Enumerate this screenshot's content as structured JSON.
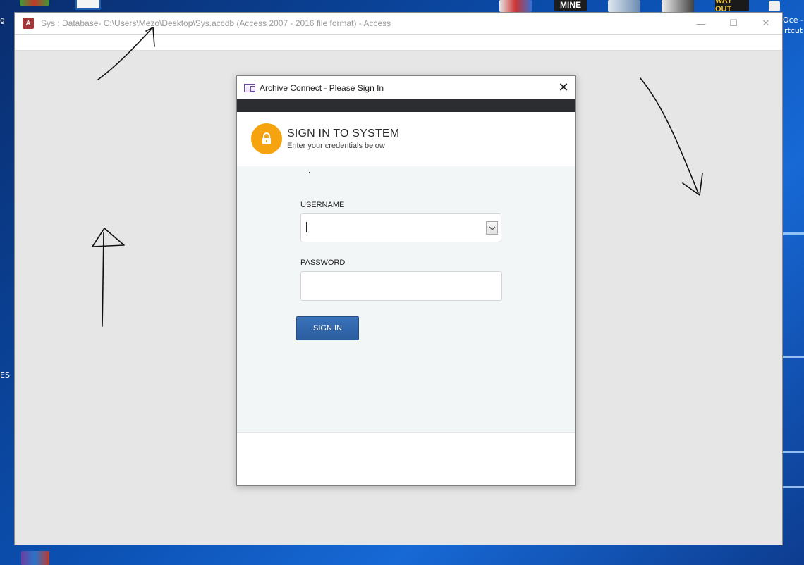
{
  "access_window": {
    "app_icon_letter": "A",
    "title": "Sys : Database- C:\\Users\\Mezo\\Desktop\\Sys.accdb (Access 2007 - 2016 file format) - Access",
    "controls": {
      "minimize": "—",
      "maximize": "☐",
      "close": "✕"
    }
  },
  "dialog": {
    "title": "Archive Connect - Please Sign In",
    "close_glyph": "✕",
    "heading": "SIGN IN TO SYSTEM",
    "subheading": "Enter your credentials below",
    "username_label": "USERNAME",
    "username_value": "",
    "password_label": "PASSWORD",
    "password_value": "",
    "signin_button": "SIGN IN"
  },
  "desktop": {
    "top_icons": [
      "MINE",
      "WAY OUT"
    ],
    "right_label_1": "Oce -",
    "right_label_2": "rtcut",
    "left_fragments": [
      "g",
      "ES"
    ]
  },
  "icons": {
    "access": "access-app-icon",
    "form": "form-icon",
    "lock": "lock-icon",
    "dropdown": "chevron-down-icon"
  },
  "colors": {
    "lock_accent": "#f5a30f",
    "signin_button": "#2f64a8",
    "dark_bar": "#2b2d31",
    "access_red": "#a4373a"
  }
}
